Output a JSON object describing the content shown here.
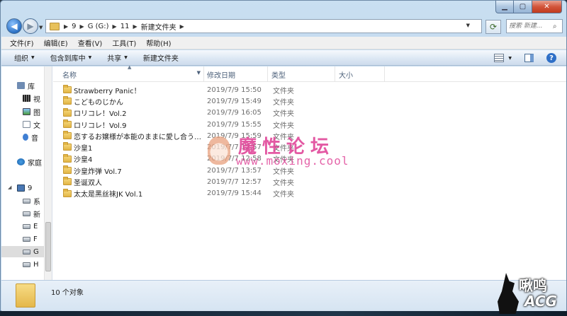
{
  "address": {
    "crumbs": [
      "9",
      "G (G:)",
      "11",
      "新建文件夹"
    ],
    "separator": "▶"
  },
  "search": {
    "placeholder": "搜索 新建..."
  },
  "menu": [
    "文件(F)",
    "编辑(E)",
    "查看(V)",
    "工具(T)",
    "帮助(H)"
  ],
  "toolbar": {
    "organize": "组织",
    "include_library": "包含到库中",
    "share": "共享",
    "new_folder": "新建文件夹"
  },
  "navpane": {
    "items": [
      {
        "label": "库"
      },
      {
        "label": "视"
      },
      {
        "label": "图"
      },
      {
        "label": "文"
      },
      {
        "label": "音"
      },
      {
        "label": "家庭"
      },
      {
        "label": "9"
      },
      {
        "label": "系"
      },
      {
        "label": "新"
      },
      {
        "label": "E"
      },
      {
        "label": "F"
      },
      {
        "label": "G"
      },
      {
        "label": "H"
      }
    ]
  },
  "columns": {
    "name": "名称",
    "date": "修改日期",
    "type": "类型",
    "size": "大小"
  },
  "files": [
    {
      "name": "Strawberry Panic！",
      "date": "2019/7/9 15:50",
      "type": "文件夹"
    },
    {
      "name": "こどものじかん",
      "date": "2019/7/9 15:49",
      "type": "文件夹"
    },
    {
      "name": "ロリコレ！Vol.2",
      "date": "2019/7/9 16:05",
      "type": "文件夹"
    },
    {
      "name": "ロリコレ！Vol.9",
      "date": "2019/7/9 15:55",
      "type": "文件夹"
    },
    {
      "name": "恋するお嬢様が本能のままに愛し合うメ...",
      "date": "2019/7/9 15:59",
      "type": "文件夹"
    },
    {
      "name": "沙皇1",
      "date": "2019/7/7 12:57",
      "type": "文件夹"
    },
    {
      "name": "沙皇4",
      "date": "2019/7/7 12:58",
      "type": "文件夹"
    },
    {
      "name": "沙皇炸弹 Vol.7",
      "date": "2019/7/7 13:57",
      "type": "文件夹"
    },
    {
      "name": "圣诞双人",
      "date": "2019/7/7 12:57",
      "type": "文件夹"
    },
    {
      "name": "太太是黑丝袜JK Vol.1",
      "date": "2019/7/9 15:44",
      "type": "文件夹"
    }
  ],
  "status": {
    "count_text": "10 个对象"
  },
  "watermark": {
    "title": "魔性论坛",
    "url": "www.moxing.cool"
  },
  "corner_logo": {
    "line1": "啾鸣",
    "line2": "ACG"
  },
  "colors": {
    "frame": "#b7d1ea",
    "close": "#c13a1e",
    "folder": "#e2b545",
    "watermark": "#e0489a"
  }
}
